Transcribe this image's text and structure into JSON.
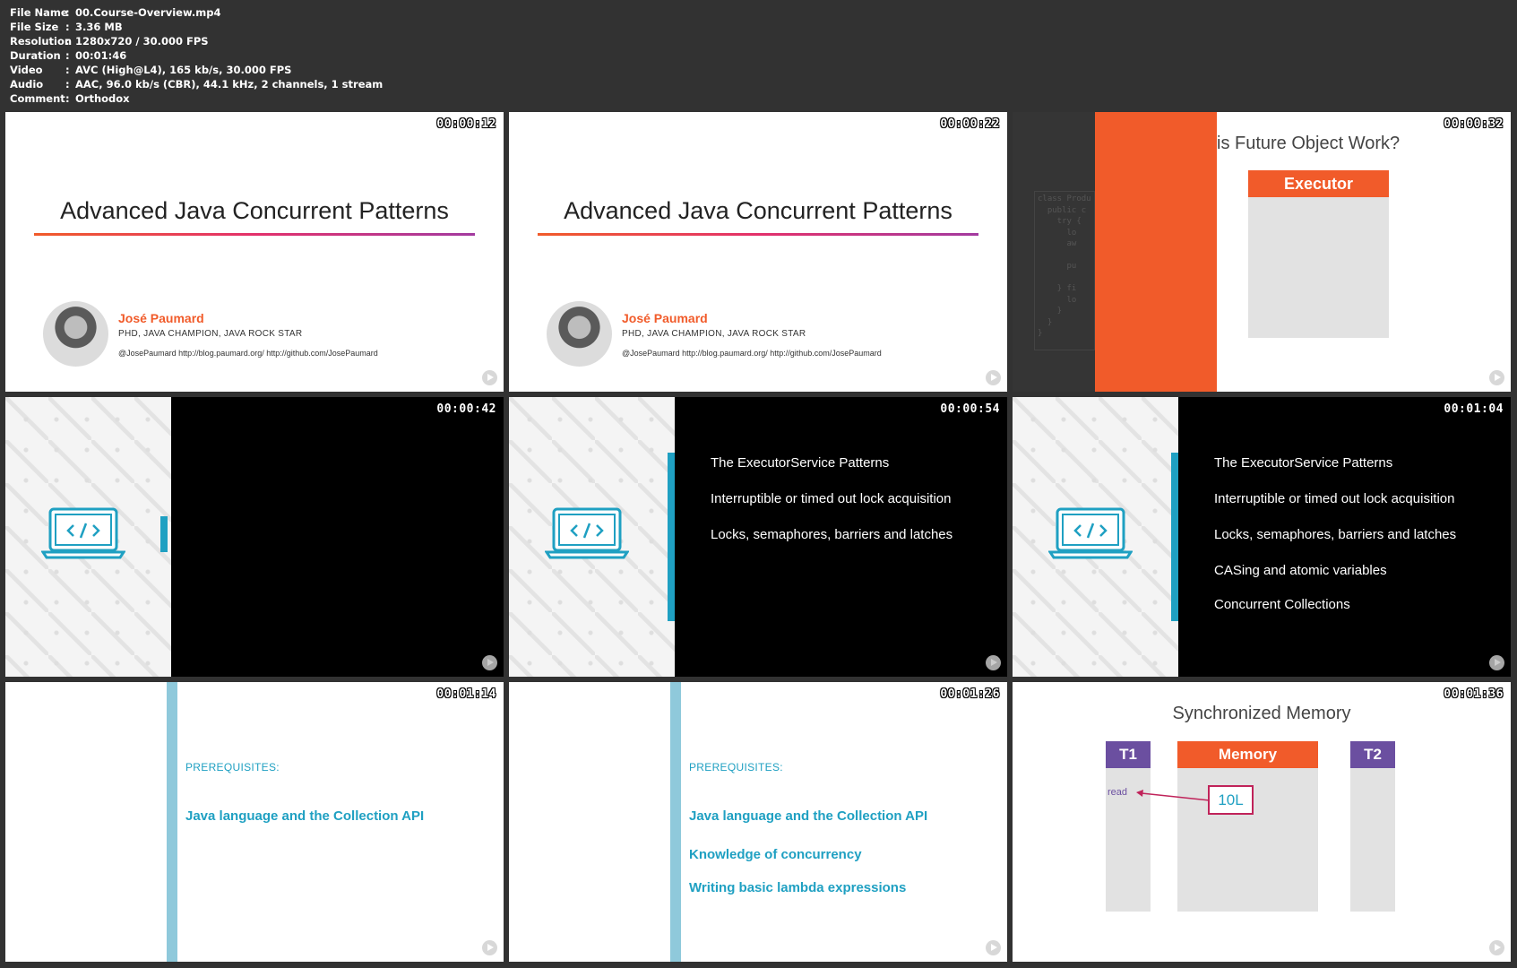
{
  "meta": [
    {
      "key": "File Name",
      "value": "00.Course-Overview.mp4"
    },
    {
      "key": "File Size",
      "value": "3.36 MB"
    },
    {
      "key": "Resolution",
      "value": "1280x720 / 30.000 FPS"
    },
    {
      "key": "Duration",
      "value": "00:01:46"
    },
    {
      "key": "Video",
      "value": "AVC (High@L4), 165 kb/s, 30.000 FPS"
    },
    {
      "key": "Audio",
      "value": "AAC, 96.0 kb/s (CBR), 44.1 kHz, 2 channels, 1 stream"
    },
    {
      "key": "Comment",
      "value": "Orthodox"
    }
  ],
  "meta_sep": ":",
  "thumbs": [
    {
      "timestamp": "00:00:12"
    },
    {
      "timestamp": "00:00:22"
    },
    {
      "timestamp": "00:00:32"
    },
    {
      "timestamp": "00:00:42"
    },
    {
      "timestamp": "00:00:54"
    },
    {
      "timestamp": "00:01:04"
    },
    {
      "timestamp": "00:01:14"
    },
    {
      "timestamp": "00:01:26"
    },
    {
      "timestamp": "00:01:36"
    }
  ],
  "title_slide": {
    "title": "Advanced Java Concurrent Patterns",
    "author": "José Paumard",
    "role": "PHD, JAVA CHAMPION, JAVA ROCK STAR",
    "links": "@JosePaumard http://blog.paumard.org/ http://github.com/JosePaumard"
  },
  "executor_slide": {
    "title": "is Future Object Work?",
    "box_label": "Executor",
    "code": "class Produ\n  public c\n    try {\n      lo\n      aw\n\n      pu\n\n    } fi\n      lo\n    }\n  }\n}"
  },
  "agenda": [
    "The ExecutorService Patterns",
    "Interruptible or timed out lock acquisition",
    "Locks, semaphores, barriers and latches",
    "CASing and atomic variables",
    "Concurrent Collections"
  ],
  "prerequisites": {
    "label": "PREREQUISITES:",
    "items": [
      "Java language and the Collection API",
      "Knowledge of concurrency",
      "Writing basic lambda expressions"
    ]
  },
  "memory_slide": {
    "title": "Synchronized Memory",
    "t1": "T1",
    "memory": "Memory",
    "t2": "T2",
    "read": "read",
    "value": "10L"
  },
  "colors": {
    "accent_orange": "#f15b2a",
    "accent_blue": "#1fa0c2",
    "accent_purple": "#6b4fa0"
  }
}
